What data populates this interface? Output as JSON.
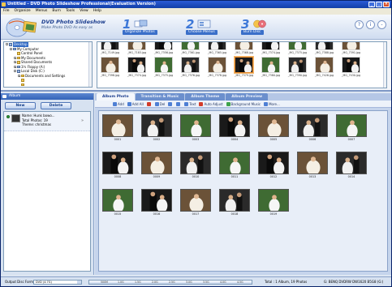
{
  "window": {
    "title": "Untitled - DVD Photo Slideshow Professional(Evaluation Version)",
    "controls": [
      "_",
      "□",
      "×"
    ]
  },
  "menu": [
    "File",
    "Organize",
    "Menus",
    "Burn",
    "Tools",
    "View",
    "Help"
  ],
  "banner": {
    "title": "DVD Photo Slideshow",
    "subtitle": "Make Photo DVD As easy as",
    "steps": [
      {
        "num": "1",
        "label": "Organize Photos"
      },
      {
        "num": "2",
        "label": "Choose Menus"
      },
      {
        "num": "3",
        "label": "Burn Disc"
      }
    ],
    "right_buttons": [
      "?",
      "i",
      "-"
    ]
  },
  "tree": {
    "items": [
      {
        "label": "Desktop",
        "indent": 0,
        "toggle": "-",
        "icon": "pc",
        "selected": true
      },
      {
        "label": "My Computer",
        "indent": 1,
        "toggle": "-",
        "icon": "pc"
      },
      {
        "label": "Control Panel",
        "indent": 2,
        "toggle": "",
        "icon": "folder"
      },
      {
        "label": "My Documents",
        "indent": 2,
        "toggle": "+",
        "icon": "folder"
      },
      {
        "label": "Shared Documents",
        "indent": 2,
        "toggle": "+",
        "icon": "folder"
      },
      {
        "label": "3½ Floppy (A:)",
        "indent": 2,
        "toggle": "+",
        "icon": "pc"
      },
      {
        "label": "Local Disk (C:)",
        "indent": 2,
        "toggle": "-",
        "icon": "pc"
      },
      {
        "label": "Documents and Settings",
        "indent": 3,
        "toggle": "+",
        "icon": "folder"
      },
      {
        "label": "",
        "indent": 3,
        "toggle": "",
        "icon": "folder"
      },
      {
        "label": "",
        "indent": 3,
        "toggle": "",
        "icon": "folder"
      }
    ]
  },
  "files": {
    "row1": [
      "_MG_7149.jpg",
      "_MG_7183.jpg",
      "_MG_7356.jpg",
      "_MG_7361.jpg",
      "_MG_7365.jpg",
      "_MG_7368.jpg",
      "_MG_7374.jpg",
      "_MG_7375.jpg",
      "_MG_7388.jpg",
      "_MG_7391.jpg"
    ],
    "row2": [
      "_MG_7398.jpg",
      "_MG_7374.jpg",
      "_MG_7375.jpg",
      "_MG_7376.jpg",
      "_MG_7378.jpg",
      "_MG_7379.jpg",
      "_MG_7380.jpg",
      "_MG_7390.jpg",
      "_MG_7426.jpg",
      "_MG_7430.jpg"
    ],
    "selected_index": 5
  },
  "album_panel": {
    "header": "Album",
    "new_label": "New",
    "delete_label": "Delete",
    "album": {
      "name": "Name: Hunk bowo...",
      "total": "Total Photos: 19",
      "theme": "Theme: christmas"
    }
  },
  "tabs": [
    "Album Photo",
    "Transition & Music",
    "Album Theme",
    "Album Preview"
  ],
  "toolbar": [
    {
      "label": "Add",
      "color": "blue"
    },
    {
      "label": "Add All",
      "color": "blue"
    },
    {
      "label": "",
      "color": "red"
    },
    {
      "label": "Del",
      "color": "blue"
    },
    {
      "label": "",
      "color": "blue"
    },
    {
      "label": "",
      "color": "blue"
    },
    {
      "label": "Text",
      "color": "blue"
    },
    {
      "label": "Auto Adjust",
      "color": "red"
    },
    {
      "label": "Background Music",
      "color": "grn"
    },
    {
      "label": "More...",
      "color": "blue"
    }
  ],
  "photos": [
    "0001",
    "0002",
    "0003",
    "0004",
    "0005",
    "0006",
    "0007",
    "0008",
    "0009",
    "0010",
    "0011",
    "0012",
    "0013",
    "0014",
    "0015",
    "0016",
    "0017",
    "0018",
    "0019"
  ],
  "status": {
    "output_label": "Output Disc Format:",
    "format_value": "DVD (4.7G)",
    "ruler": [
      "500M",
      "1.0G",
      "1.5G",
      "2.0G",
      "2.5G",
      "3.0G",
      "3.5G",
      "4.0G",
      "4.5G"
    ],
    "total": "Total : 1 Album, 19 Photos",
    "drive": "G: BENQ DVDRW DW1620 B5G8 (G:)"
  }
}
